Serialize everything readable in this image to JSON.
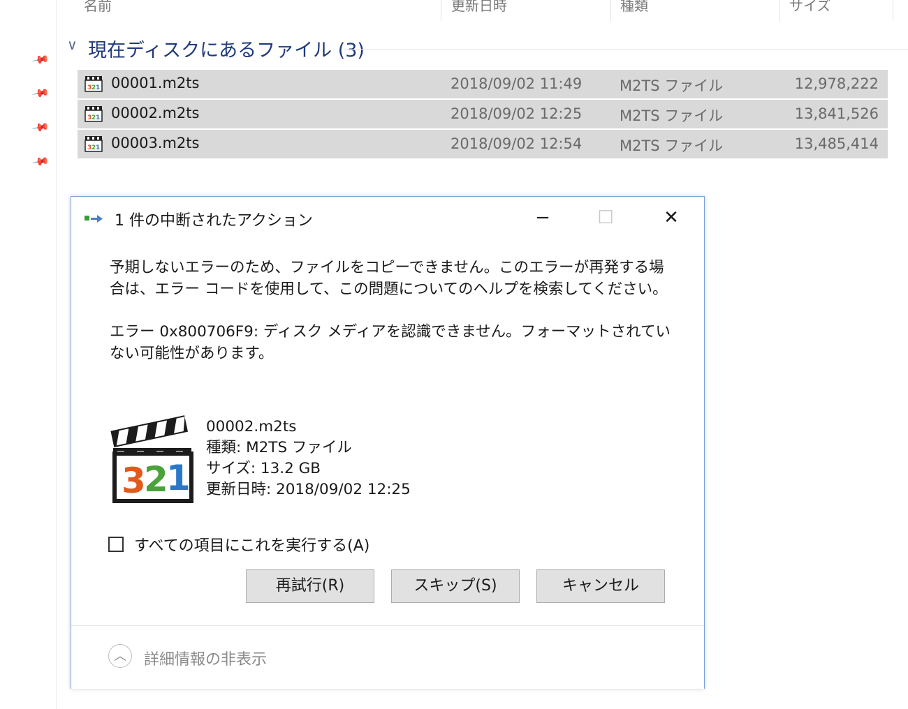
{
  "columns": {
    "name": "名前",
    "modified": "更新日時",
    "type": "種類",
    "size": "サイズ"
  },
  "group": {
    "title": "現在ディスクにあるファイル (3)"
  },
  "files": [
    {
      "name": "00001.m2ts",
      "date": "2018/09/02 11:49",
      "type": "M2TS ファイル",
      "size": "12,978,222"
    },
    {
      "name": "00002.m2ts",
      "date": "2018/09/02 12:25",
      "type": "M2TS ファイル",
      "size": "13,841,526"
    },
    {
      "name": "00003.m2ts",
      "date": "2018/09/02 12:54",
      "type": "M2TS ファイル",
      "size": "13,485,414"
    }
  ],
  "dialog": {
    "title": "1 件の中断されたアクション",
    "message1": "予期しないエラーのため、ファイルをコピーできません。このエラーが再発する場合は、エラー コードを使用して、この問題についてのヘルプを検索してください。",
    "message2": "エラー 0x800706F9: ディスク メディアを認識できません。フォーマットされていない可能性があります。",
    "file": {
      "name": "00002.m2ts",
      "type": "種類: M2TS ファイル",
      "size": "サイズ: 13.2 GB",
      "modified": "更新日時: 2018/09/02 12:25"
    },
    "apply_all_label": "すべての項目にこれを実行する(A)",
    "buttons": {
      "retry": "再試行(R)",
      "skip": "スキップ(S)",
      "cancel": "キャンセル"
    },
    "details_toggle": "詳細情報の非表示"
  },
  "icons": {
    "file": "media-clapperboard-icon",
    "pin": "pin-icon",
    "title": "copy-transfer-icon"
  },
  "colors": {
    "selection": "#d9d9d9",
    "dialog_border": "#7aa5d6",
    "group_title": "#1f3a7a"
  }
}
